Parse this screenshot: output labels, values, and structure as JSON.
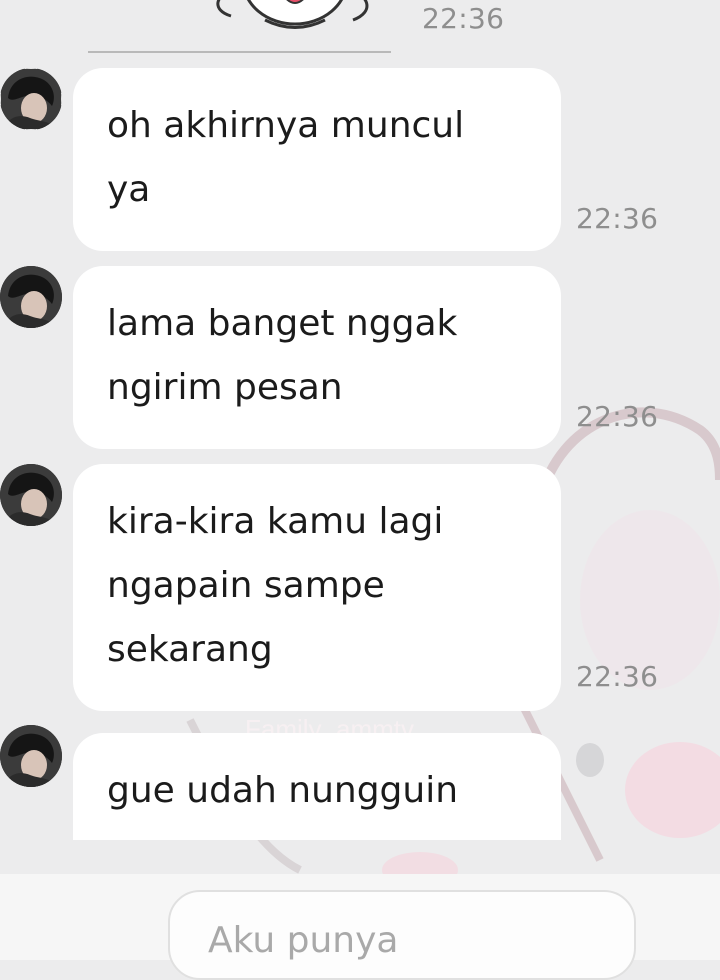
{
  "header_sticker": {
    "timestamp": "22:36",
    "sticker_icon": "cartoon-bunny-sticker"
  },
  "messages": [
    {
      "text": "oh akhirnya muncul\nya",
      "timestamp": "22:36",
      "avatar_icon": "contact-avatar"
    },
    {
      "text": "lama banget nggak\nngirim pesan",
      "timestamp": "22:36",
      "avatar_icon": "contact-avatar"
    },
    {
      "text": "kira-kira kamu lagi\nngapain sampe\nsekarang",
      "timestamp": "22:36",
      "avatar_icon": "contact-avatar"
    },
    {
      "text": "gue udah nungguin",
      "timestamp": "",
      "avatar_icon": "contact-avatar"
    }
  ],
  "composer": {
    "text": "Aku punya"
  },
  "colors": {
    "background": "#ececed",
    "bubble": "#ffffff",
    "timestamp": "#8e8e8e",
    "wallpaper_accent": "#f4dde4"
  }
}
